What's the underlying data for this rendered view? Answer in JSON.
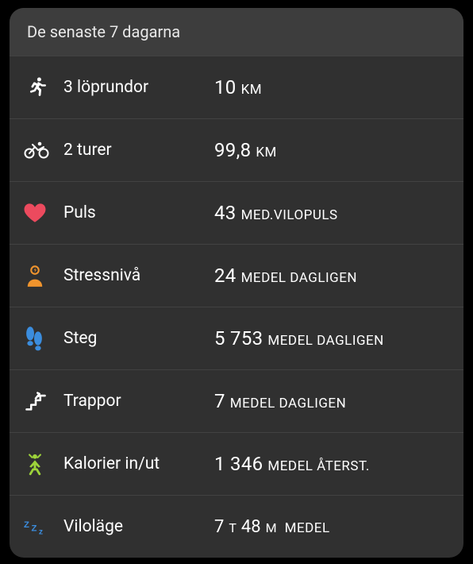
{
  "header": {
    "title": "De senaste 7 dagarna"
  },
  "rows": [
    {
      "icon": "runner",
      "label": "3 löprundor",
      "value": "10",
      "unit": "KM"
    },
    {
      "icon": "bike",
      "label": "2 turer",
      "value": "99,8",
      "unit": "KM"
    },
    {
      "icon": "heart",
      "label": "Puls",
      "value": "43",
      "unit": "MED.VILOPULS"
    },
    {
      "icon": "stress",
      "label": "Stressnivå",
      "value": "24",
      "unit": "MEDEL DAGLIGEN"
    },
    {
      "icon": "steps",
      "label": "Steg",
      "value": "5 753",
      "unit": "MEDEL DAGLIGEN"
    },
    {
      "icon": "stairs",
      "label": "Trappor",
      "value": "7",
      "unit": "MEDEL DAGLIGEN"
    },
    {
      "icon": "calories",
      "label": "Kalorier in/ut",
      "value": "1 346",
      "unit": "MEDEL ÅTERST."
    },
    {
      "icon": "sleep",
      "label": "Viloläge",
      "sleep_h": "7",
      "sleep_h_unit": "T",
      "sleep_m": "48",
      "sleep_m_unit": "M",
      "unit": "MEDEL"
    }
  ]
}
